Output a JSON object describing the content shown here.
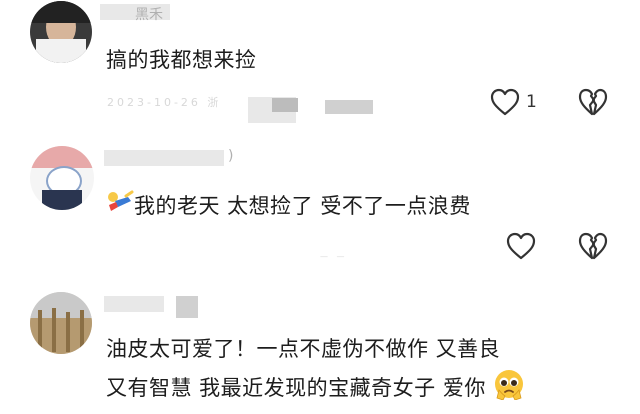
{
  "comments": [
    {
      "username": "黑禾",
      "text": "搞的我都想来捡",
      "time": "2023-10-26 浙",
      "like_count": "1"
    },
    {
      "username": ")",
      "text": "我的老天 太想捡了 受不了一点浪费",
      "time": "— —"
    },
    {
      "text_line1": "油皮太可爱了！一点不虚伪不做作 又善良",
      "text_line2": "又有智慧 我最近发现的宝藏奇女子 爱你"
    }
  ],
  "icons": {
    "like": "heart-outline-icon",
    "dislike": "broken-heart-icon",
    "emoji_tumble": "tumbling-person-emoji",
    "emoji_pleading": "pleading-face-emoji"
  },
  "colors": {
    "text": "#1d1d1d",
    "muted": "#b0b0b0",
    "icon": "#333333"
  }
}
